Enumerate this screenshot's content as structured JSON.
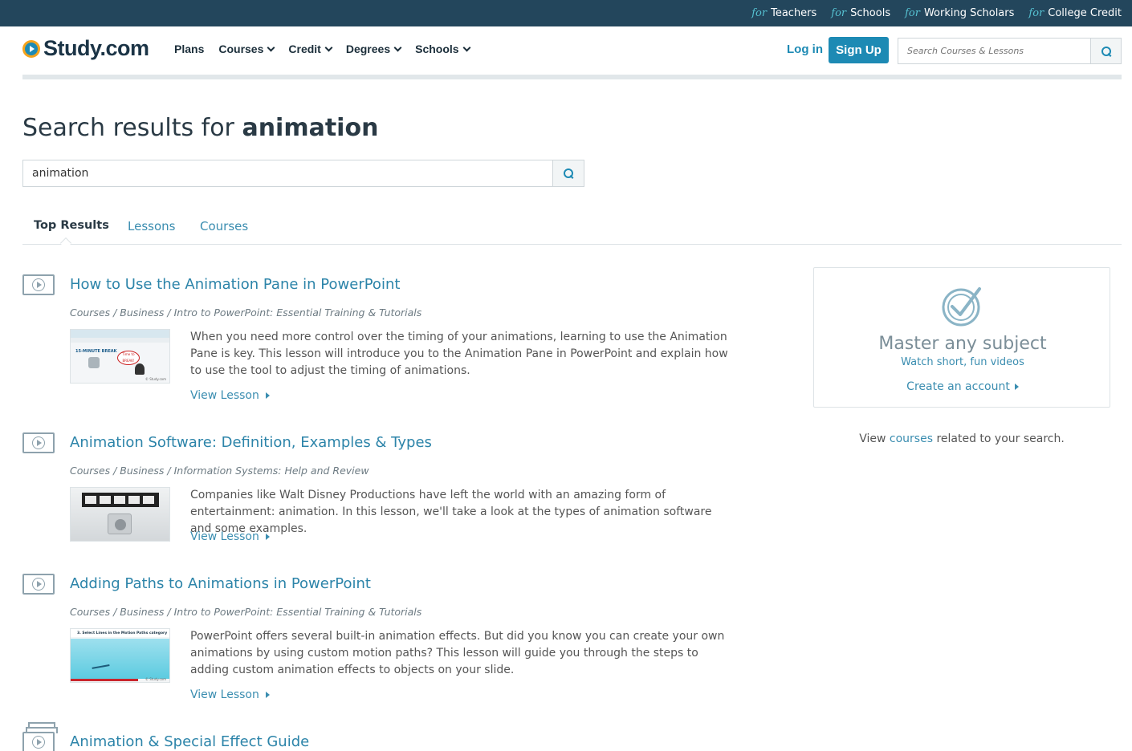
{
  "topbar": {
    "for_label": "for",
    "links": [
      "Teachers",
      "Schools",
      "Working Scholars",
      "College Credit"
    ]
  },
  "header": {
    "logo_text": "Study.com",
    "nav": [
      "Plans",
      "Courses",
      "Credit",
      "Degrees",
      "Schools"
    ],
    "login_label": "Log in",
    "signup_label": "Sign Up",
    "search_placeholder": "Search Courses & Lessons"
  },
  "page": {
    "title_prefix": "Search results for",
    "query": "animation"
  },
  "search": {
    "value": "animation"
  },
  "tabs": [
    "Top Results",
    "Lessons",
    "Courses"
  ],
  "results": [
    {
      "title": "How to Use the Animation Pane in PowerPoint",
      "crumb": "Courses / Business / Intro to PowerPoint: Essential Training & Tutorials",
      "desc": "When you need more control over the timing of your animations, learning to use the Animation Pane is key. This lesson will introduce you to the Animation Pane in PowerPoint and explain how to use the tool to adjust the timing of animations.",
      "link": "View Lesson",
      "thumb_text": "15-MINUTE BREAK",
      "thumb_bubble": "Time to BREAK!",
      "thumb_watermark": "© Study.com"
    },
    {
      "title": "Animation Software: Definition, Examples & Types",
      "crumb": "Courses / Business / Information Systems: Help and Review",
      "desc": "Companies like Walt Disney Productions have left the world with an amazing form of entertainment: animation. In this lesson, we'll take a look at the types of animation software and some examples.",
      "link": "View Lesson"
    },
    {
      "title": "Adding Paths to Animations in PowerPoint",
      "crumb": "Courses / Business / Intro to PowerPoint: Essential Training & Tutorials",
      "desc": "PowerPoint offers several built-in animation effects. But did you know you can create your own animations by using custom motion paths? This lesson will guide you through the steps to adding custom animation effects to objects on your slide.",
      "link": "View Lesson",
      "thumb_header": "3. Select Lines in the Motion Paths category",
      "thumb_watermark": "© Study.com"
    },
    {
      "title": "Animation & Special Effect Guide"
    }
  ],
  "sidebar": {
    "promo_title": "Master any subject",
    "promo_sub": "Watch short, fun videos",
    "promo_cta": "Create an account",
    "related_prefix": "View",
    "related_link": "courses",
    "related_suffix": "related to your search."
  },
  "colors": {
    "topbar_bg": "#23465c",
    "accent": "#1d8ab4",
    "link": "#2c84a9"
  }
}
